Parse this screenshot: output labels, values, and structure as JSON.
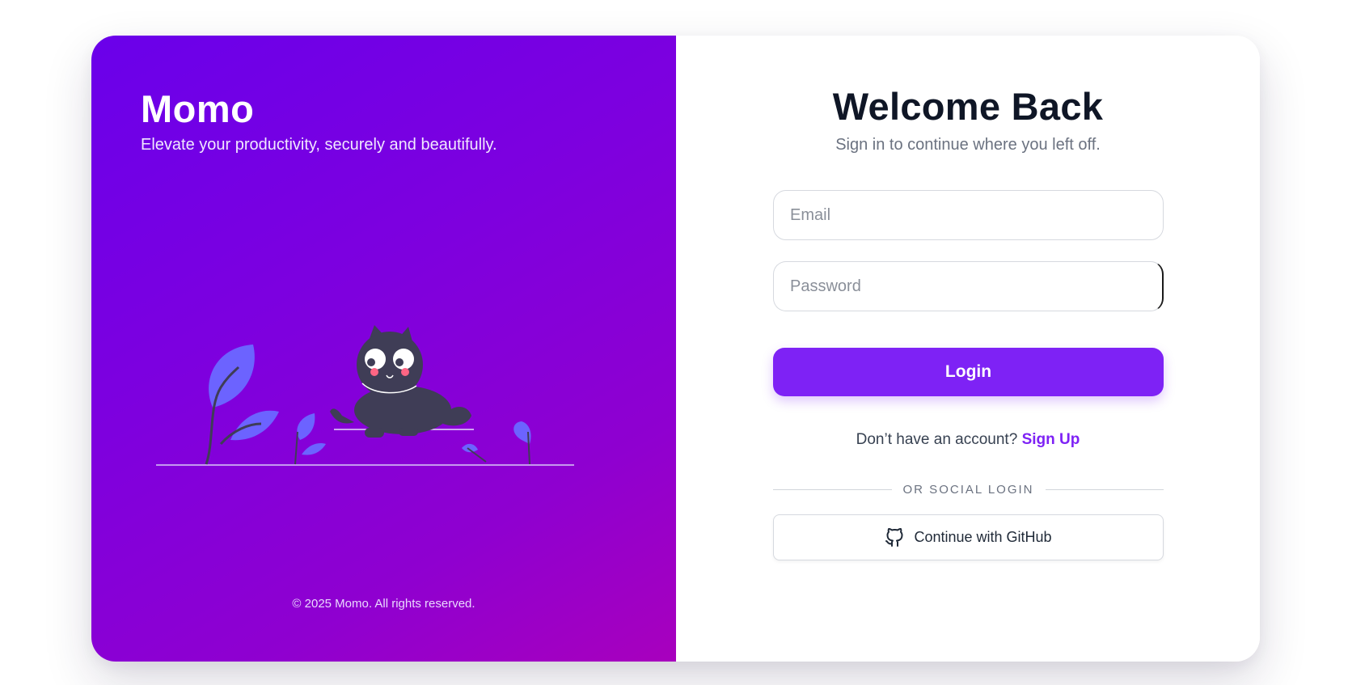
{
  "left": {
    "brand": "Momo",
    "tagline": "Elevate your productivity, securely and beautifully.",
    "copyright": "© 2025 Momo. All rights reserved."
  },
  "right": {
    "title": "Welcome Back",
    "subtitle": "Sign in to continue where you left off.",
    "email_placeholder": "Email",
    "password_placeholder": "Password",
    "login_label": "Login",
    "signup_prompt": "Don’t have an account?",
    "signup_link": "Sign Up",
    "divider_text": "OR SOCIAL LOGIN",
    "github_label": "Continue with GitHub",
    "github_icon": "github-icon"
  },
  "colors": {
    "accent": "#7e22f5",
    "gradient_start": "#6a00ea",
    "gradient_end": "#a800bd",
    "heading": "#0f1626",
    "illustration_leaf": "#6c63ff",
    "illustration_cat": "#3f3d56",
    "cheek": "#ff6584"
  }
}
